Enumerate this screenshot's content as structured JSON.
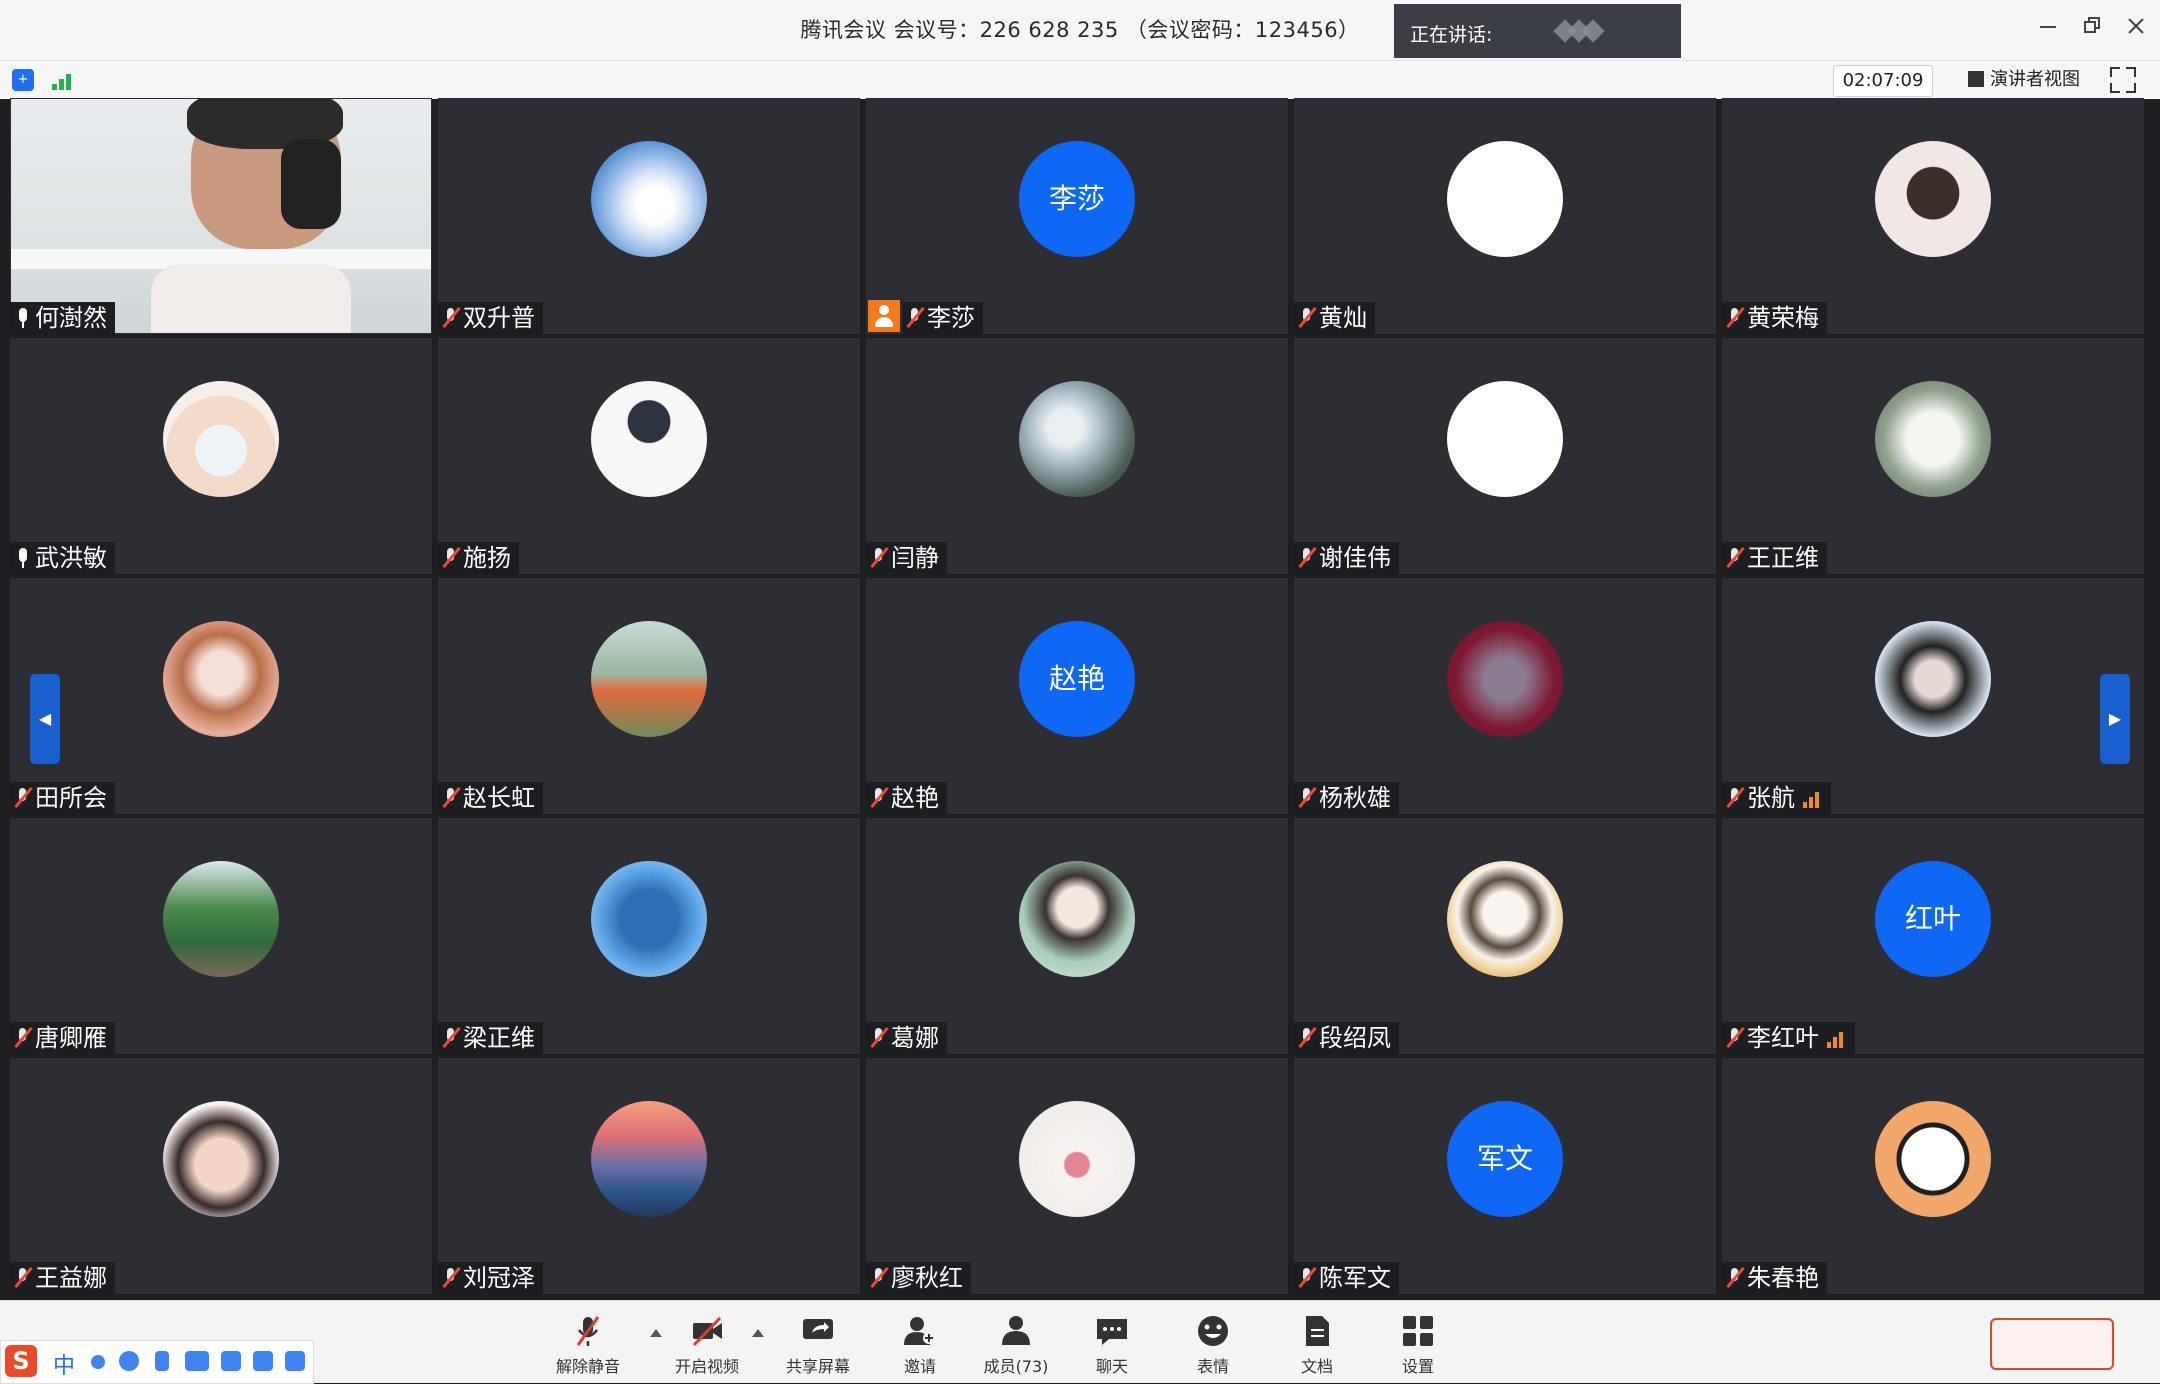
{
  "window": {
    "title": "腾讯会议 会议号：226 628 235 （会议密码：123456）",
    "speaking_label": "正在讲话:",
    "controls": [
      "minimize",
      "restore",
      "close"
    ]
  },
  "toolbar": {
    "timer": "02:07:09",
    "speaker_view": "演讲者视图"
  },
  "participants": [
    {
      "name": "何澍然",
      "mic": "on",
      "avatar": "video"
    },
    {
      "name": "双升普",
      "mic": "muted",
      "avatar": "cloud"
    },
    {
      "name": "李莎",
      "mic": "muted",
      "avatar": "text",
      "avatar_text": "李莎",
      "host": true
    },
    {
      "name": "黄灿",
      "mic": "muted",
      "avatar": "sketch"
    },
    {
      "name": "黄荣梅",
      "mic": "muted",
      "avatar": "girl"
    },
    {
      "name": "武洪敏",
      "mic": "on",
      "avatar": "cat"
    },
    {
      "name": "施扬",
      "mic": "muted",
      "avatar": "anime-boy"
    },
    {
      "name": "闫静",
      "mic": "muted",
      "avatar": "flowers"
    },
    {
      "name": "谢佳伟",
      "mic": "muted",
      "avatar": "white"
    },
    {
      "name": "王正维",
      "mic": "muted",
      "avatar": "toy"
    },
    {
      "name": "田所会",
      "mic": "muted",
      "avatar": "anime-girl"
    },
    {
      "name": "赵长虹",
      "mic": "muted",
      "avatar": "meadow"
    },
    {
      "name": "赵艳",
      "mic": "muted",
      "avatar": "text",
      "avatar_text": "赵艳"
    },
    {
      "name": "杨秋雄",
      "mic": "muted",
      "avatar": "tom"
    },
    {
      "name": "张航",
      "mic": "muted",
      "avatar": "photo-girl",
      "signal": true
    },
    {
      "name": "唐卿雁",
      "mic": "muted",
      "avatar": "garden"
    },
    {
      "name": "梁正维",
      "mic": "muted",
      "avatar": "blue-desk"
    },
    {
      "name": "葛娜",
      "mic": "muted",
      "avatar": "drawn-girl"
    },
    {
      "name": "段绍凤",
      "mic": "muted",
      "avatar": "sunglasses"
    },
    {
      "name": "李红叶",
      "mic": "muted",
      "avatar": "text",
      "avatar_text": "红叶",
      "signal": true
    },
    {
      "name": "王益娜",
      "mic": "muted",
      "avatar": "baby"
    },
    {
      "name": "刘冠泽",
      "mic": "muted",
      "avatar": "sunset"
    },
    {
      "name": "廖秋红",
      "mic": "muted",
      "avatar": "rose"
    },
    {
      "name": "陈军文",
      "mic": "muted",
      "avatar": "text",
      "avatar_text": "军文"
    },
    {
      "name": "朱春艳",
      "mic": "muted",
      "avatar": "headphones"
    }
  ],
  "bottombar": {
    "unmute": "解除静音",
    "start_video": "开启视频",
    "share_screen": "共享屏幕",
    "invite": "邀请",
    "members": "成员(73)",
    "chat": "聊天",
    "reactions": "表情",
    "docs": "文档",
    "settings": "设置"
  },
  "ime": {
    "mode": "中"
  },
  "colors": {
    "tile_bg": "#2c2e33",
    "accent_blue": "#0e68f5",
    "muted_red": "#ea4a34",
    "signal_orange": "#f08a24"
  }
}
